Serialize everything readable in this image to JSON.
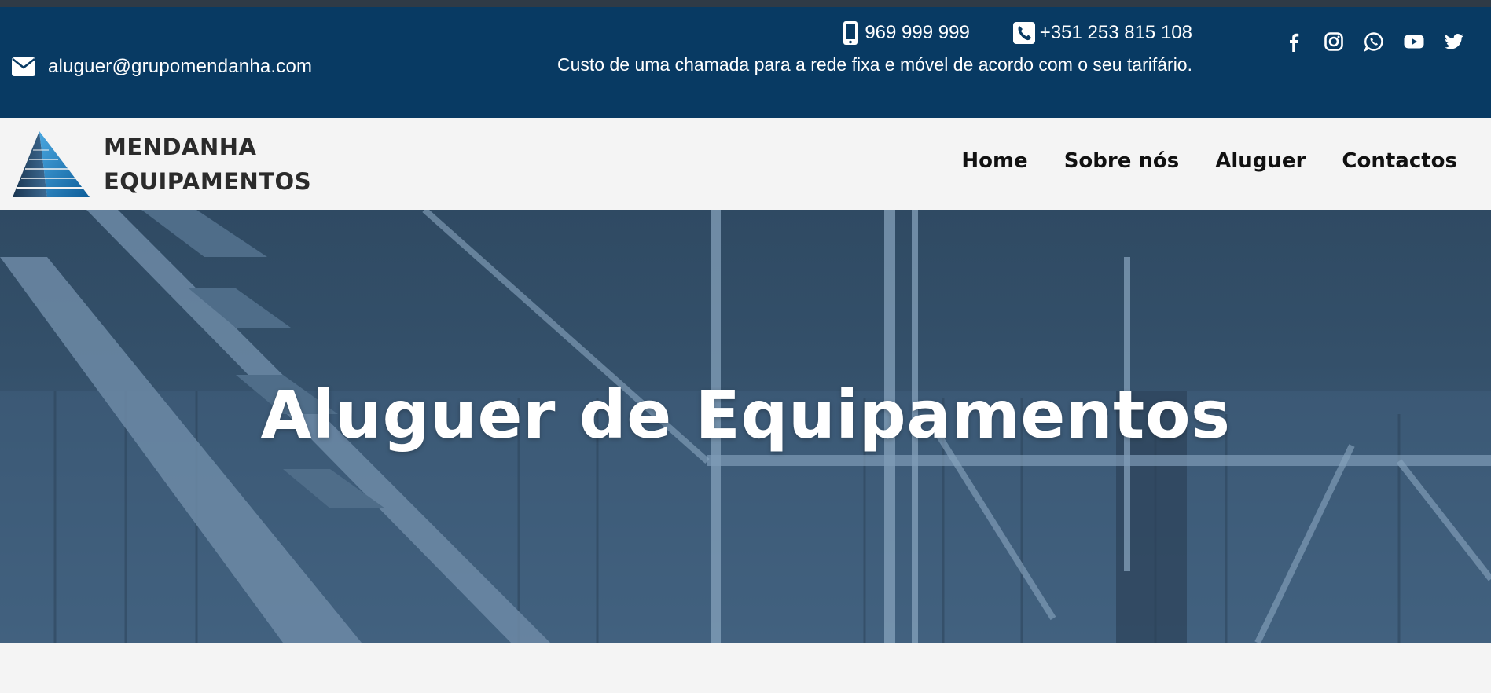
{
  "contact": {
    "email": "aluguer@grupomendanha.com",
    "mobile": "969 999 999",
    "landline": "+351 253 815 108",
    "call_note": "Custo de uma chamada para a rede fixa e móvel de acordo com o seu tarifário."
  },
  "social": [
    "facebook-icon",
    "instagram-icon",
    "whatsapp-icon",
    "youtube-icon",
    "twitter-icon"
  ],
  "brand": {
    "line1": "MENDANHA",
    "line2": "EQUIPAMENTOS"
  },
  "nav": {
    "home": "Home",
    "about": "Sobre nós",
    "rental": "Aluguer",
    "contacts": "Contactos"
  },
  "hero": {
    "title": "Aluguer de Equipamentos"
  },
  "colors": {
    "topbar": "#083a63",
    "hero_overlay": "#314b64",
    "background": "#f4f4f4",
    "logo_blue": "#1e7fc2"
  }
}
